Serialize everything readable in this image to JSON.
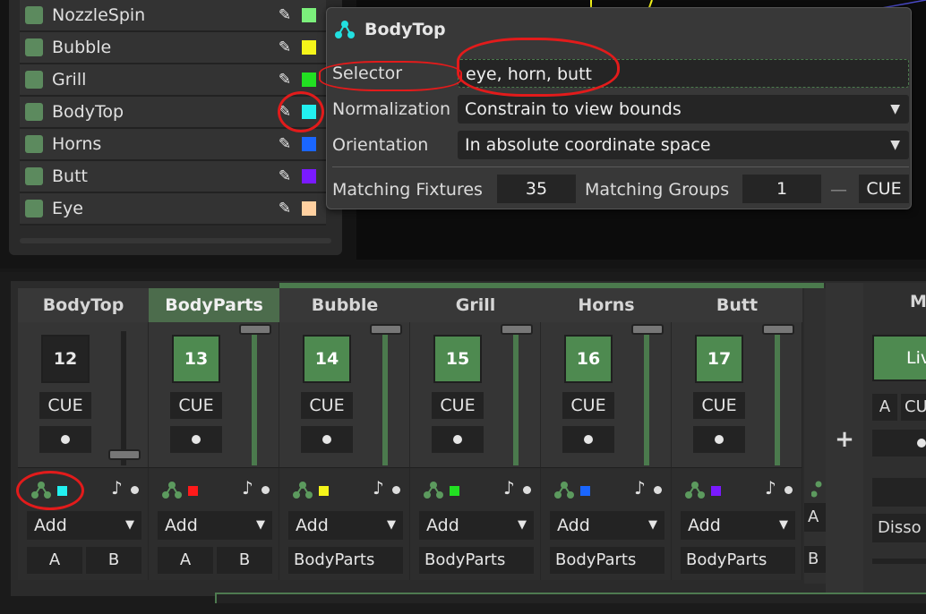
{
  "group_list": [
    {
      "name": "NozzleSpin",
      "color": "#7cf07c"
    },
    {
      "name": "Bubble",
      "color": "#f5f51a"
    },
    {
      "name": "Grill",
      "color": "#22e022"
    },
    {
      "name": "BodyTop",
      "color": "#22f0f0"
    },
    {
      "name": "Horns",
      "color": "#1a66ff"
    },
    {
      "name": "Butt",
      "color": "#7a1aff"
    },
    {
      "name": "Eye",
      "color": "#ffd0a0"
    }
  ],
  "popup": {
    "title": "BodyTop",
    "selector_label": "Selector",
    "selector_value": "eye, horn, butt",
    "normalization_label": "Normalization",
    "normalization_value": "Constrain to view bounds",
    "orientation_label": "Orientation",
    "orientation_value": "In absolute coordinate space",
    "matching_fixtures_label": "Matching Fixtures",
    "matching_fixtures_value": "35",
    "matching_groups_label": "Matching Groups",
    "matching_groups_value": "1",
    "dash": "—",
    "cue_label": "CUE"
  },
  "strips": [
    {
      "title": "BodyTop",
      "number": "12",
      "cue": "CUE",
      "color": "#22f0f0",
      "blend": "Add",
      "a": "A",
      "b": "B",
      "group": ""
    },
    {
      "title": "BodyParts",
      "number": "13",
      "cue": "CUE",
      "color": "#ff1a1a",
      "blend": "Add",
      "a": "A",
      "b": "B",
      "group": ""
    },
    {
      "title": "Bubble",
      "number": "14",
      "cue": "CUE",
      "color": "#f5f51a",
      "blend": "Add",
      "a": "",
      "b": "",
      "group": "BodyParts"
    },
    {
      "title": "Grill",
      "number": "15",
      "cue": "CUE",
      "color": "#22e022",
      "blend": "Add",
      "a": "",
      "b": "",
      "group": "BodyParts"
    },
    {
      "title": "Horns",
      "number": "16",
      "cue": "CUE",
      "color": "#1a66ff",
      "blend": "Add",
      "a": "",
      "b": "",
      "group": "BodyParts"
    },
    {
      "title": "Butt",
      "number": "17",
      "cue": "CUE",
      "color": "#7a1aff",
      "blend": "Add",
      "a": "",
      "b": "",
      "group": "BodyParts"
    }
  ],
  "partial_strip": {
    "blend_initial": "A",
    "group_initial": "B"
  },
  "add_button_label": "+",
  "master": {
    "title": "M",
    "live_label": "Liv",
    "a_label": "A",
    "cue_label": "CU",
    "dissolve_label": "Disso"
  },
  "icons": {
    "edit": "pencil-icon",
    "group": "group-nodes-icon",
    "audio": "music-note-icon",
    "dropdown": "chevron-down-icon"
  }
}
